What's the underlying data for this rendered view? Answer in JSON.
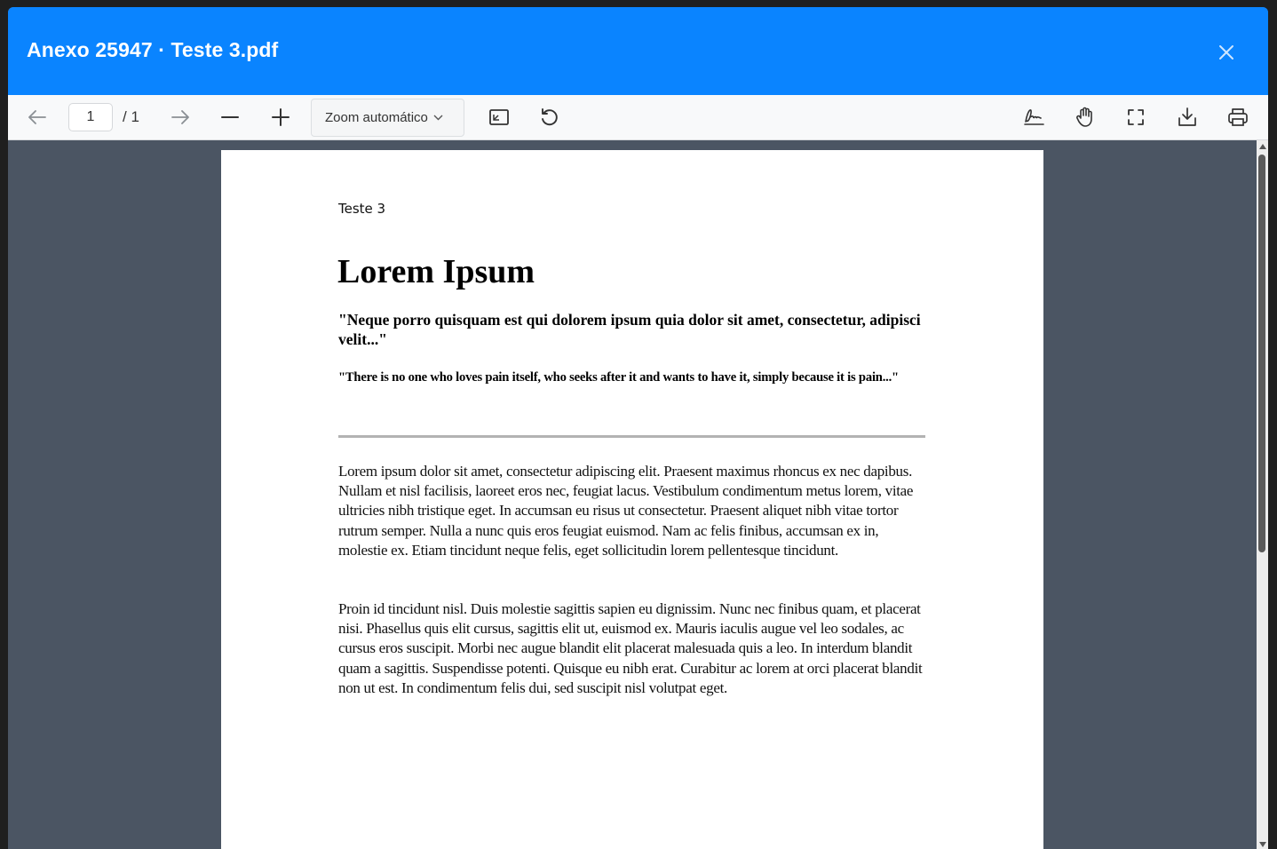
{
  "modal": {
    "title": "Anexo 25947 · Teste 3.pdf"
  },
  "toolbar": {
    "page_current": "1",
    "page_total": "/ 1",
    "zoom_label": "Zoom automático",
    "icons": {
      "prev": "arrow-left-icon",
      "next": "arrow-right-icon",
      "zoom_out": "minus-icon",
      "zoom_in": "plus-icon",
      "fit": "fit-page-icon",
      "rotate": "rotate-icon",
      "sign": "signature-icon",
      "hand": "hand-tool-icon",
      "fullscreen": "fullscreen-icon",
      "download": "download-icon",
      "print": "print-icon"
    }
  },
  "document": {
    "header": "Teste 3",
    "title": "Lorem Ipsum",
    "quote1": "\"Neque porro quisquam est qui dolorem ipsum quia dolor sit amet, consectetur, adipisci velit...\"",
    "quote2": "\"There is no one who loves pain itself, who seeks after it and wants to have it, simply because it is pain...\"",
    "paragraph1": "Lorem ipsum dolor sit amet, consectetur adipiscing elit. Praesent maximus rhoncus ex nec dapibus. Nullam et nisl facilisis, laoreet eros nec, feugiat lacus. Vestibulum condimentum metus lorem, vitae ultricies nibh tristique eget. In accumsan eu risus ut consectetur. Praesent aliquet nibh vitae tortor rutrum semper. Nulla a nunc quis eros feugiat euismod. Nam ac felis finibus, accumsan ex in, molestie ex. Etiam tincidunt neque felis, eget sollicitudin lorem pellentesque tincidunt.",
    "paragraph2": "Proin id tincidunt nisl. Duis molestie sagittis sapien eu dignissim. Nunc nec finibus quam, et placerat nisi. Phasellus quis elit cursus, sagittis elit ut, euismod ex. Mauris iaculis augue vel leo sodales, ac cursus eros suscipit. Morbi nec augue blandit elit placerat malesuada quis a leo. In interdum blandit quam a sagittis. Suspendisse potenti. Quisque eu nibh erat. Curabitur ac lorem at orci placerat blandit non ut est. In condimentum felis dui, sed suscipit nisl volutpat eget."
  },
  "colors": {
    "header_blue": "#0a84ff",
    "viewer_bg": "#4b5563",
    "toolbar_bg": "#f8f9fa"
  }
}
